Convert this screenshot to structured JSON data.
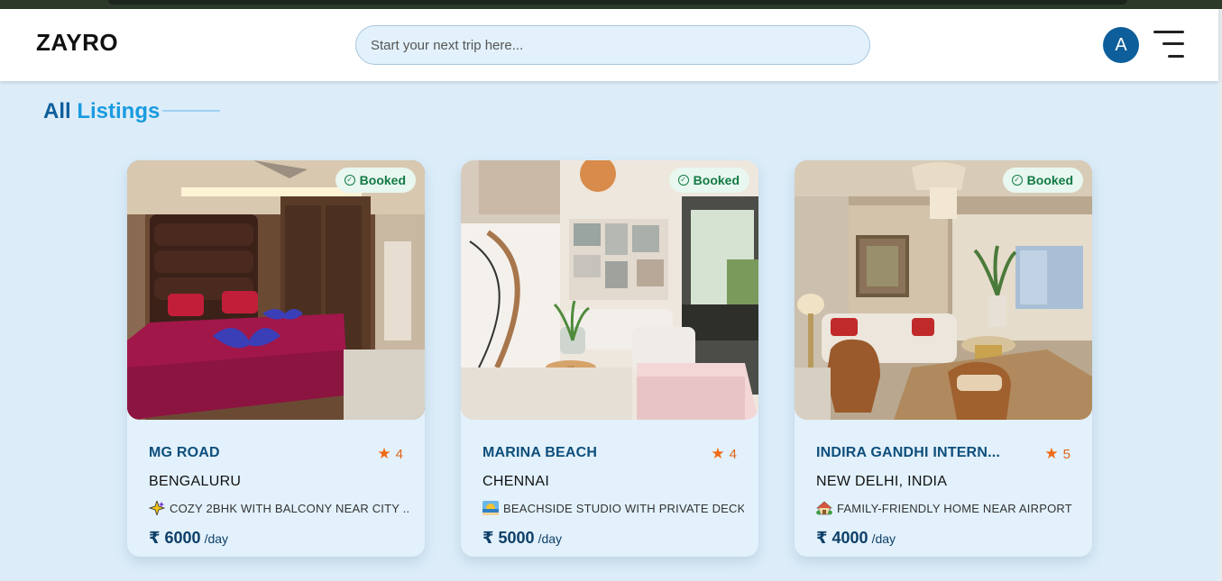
{
  "app": {
    "logo": "ZAYRO",
    "search_placeholder": "Start your next trip here...",
    "avatar_initial": "A",
    "accent_color": "#0d5e9a",
    "accent_light": "#1a9be0"
  },
  "section": {
    "title_part1": "All",
    "title_part2": "Listings"
  },
  "listings": [
    {
      "status": "Booked",
      "location": "MG ROAD",
      "rating": "4",
      "city": "BENGALURU",
      "description": "COZY 2BHK WITH BALCONY NEAR CITY ...",
      "description_icon": "sparkle-icon",
      "price": "₹ 6000",
      "per": "/day"
    },
    {
      "status": "Booked",
      "location": "MARINA BEACH",
      "rating": "4",
      "city": "CHENNAI",
      "description": "BEACHSIDE STUDIO WITH PRIVATE DECK",
      "description_icon": "beach-sunset-icon",
      "price": "₹ 5000",
      "per": "/day"
    },
    {
      "status": "Booked",
      "location": "INDIRA GANDHI INTERN...",
      "rating": "5",
      "city": "NEW DELHI, INDIA",
      "description": "FAMILY-FRIENDLY HOME NEAR AIRPORT",
      "description_icon": "house-garden-icon",
      "price": "₹ 4000",
      "per": "/day"
    }
  ]
}
